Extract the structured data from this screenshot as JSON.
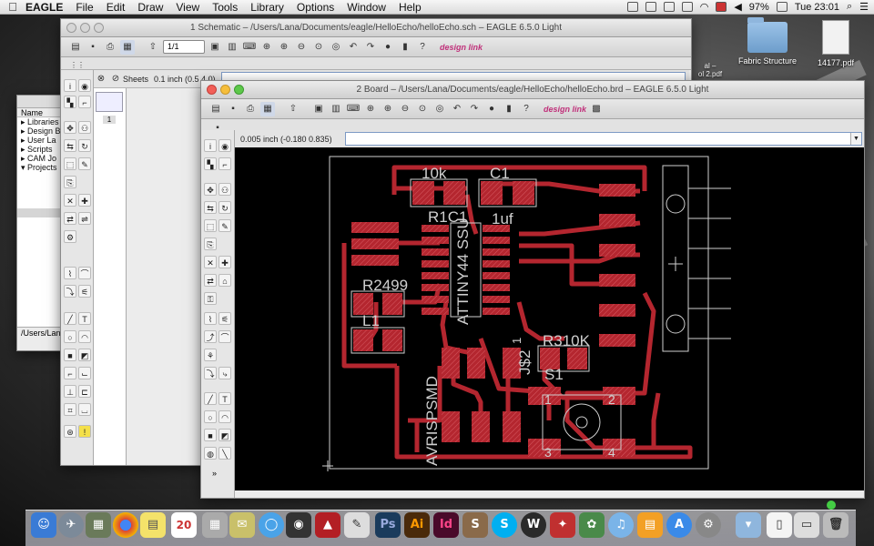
{
  "menubar": {
    "apple": "",
    "app_name": "EAGLE",
    "menus": [
      "File",
      "Edit",
      "Draw",
      "View",
      "Tools",
      "Library",
      "Options",
      "Window",
      "Help"
    ],
    "battery": "97%",
    "clock": "Tue 23:01"
  },
  "desktop": {
    "icons": [
      {
        "label": "Fabric Structure",
        "type": "folder-icon"
      },
      {
        "label": "14177.pdf",
        "type": "document-icon"
      },
      {
        "label": "al –",
        "type": "document-icon"
      },
      {
        "label": "ol 2.pdf",
        "type": "document-icon"
      }
    ]
  },
  "explorer": {
    "column_header": "Name",
    "items": [
      "Libraries",
      "Design B",
      "User La",
      "Scripts",
      "CAM Jo",
      "Projects"
    ],
    "path": "/Users/Lana/"
  },
  "schematic": {
    "title": "1 Schematic – /Users/Lana/Documents/eagle/HelloEcho/helloEcho.sch – EAGLE 6.5.0 Light",
    "sheet_combo": "1/1",
    "sheets_label": "Sheets",
    "coord": "0.1 inch (0.5 4.0)",
    "sheet_number": "1",
    "brand": "design link"
  },
  "board": {
    "title": "2 Board – /Users/Lana/Documents/eagle/HelloEcho/helloEcho.brd – EAGLE 6.5.0 Light",
    "coord": "0.005 inch (-0.180 0.835)",
    "brand": "design link",
    "labels": {
      "r1": "10k",
      "c1": "C1",
      "ric1": "R1C1",
      "uf": "1uf",
      "r2": "R2499",
      "l1": "L1",
      "ic": "ATTINY44 SSU",
      "r3": "R310K",
      "s1": "S1",
      "j": "J$2",
      "avr": "AVRISPSMD",
      "one": "1",
      "p1": "1",
      "p2": "2",
      "p3": "3",
      "p4": "4"
    }
  },
  "dock": {
    "apps": [
      "Ps",
      "Ai",
      "Id",
      "S",
      "S",
      "W",
      "20"
    ]
  },
  "colors": {
    "trace": "#b4262f",
    "pad": "#b4262f",
    "silk": "#cfcfcf",
    "board_bg": "#000000"
  }
}
